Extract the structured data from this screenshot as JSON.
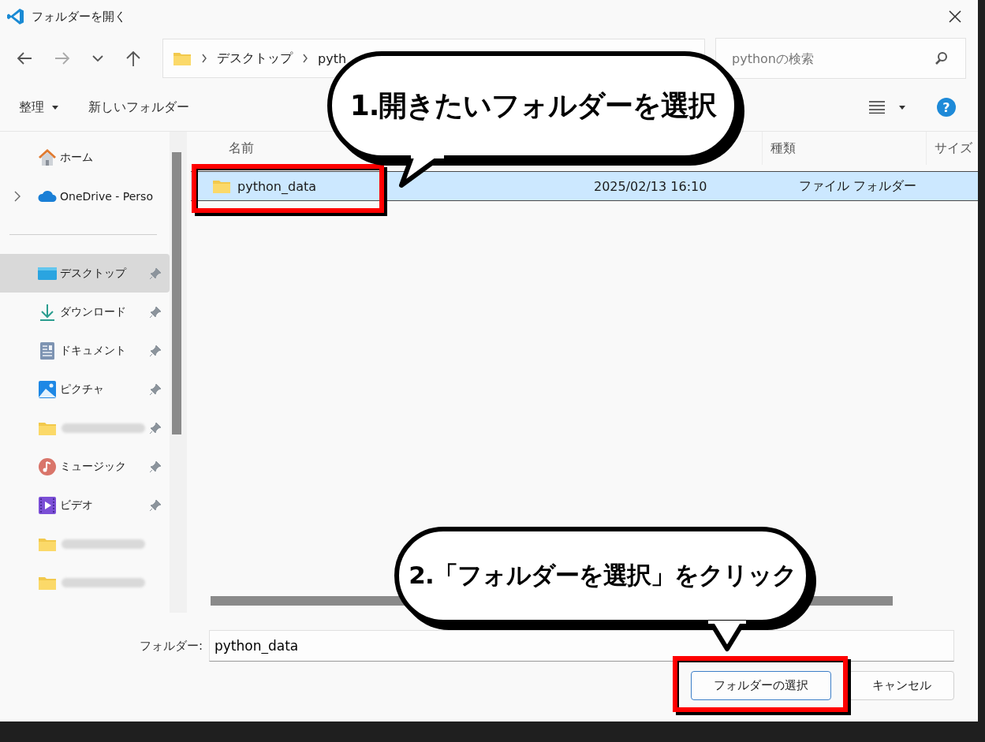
{
  "window": {
    "title": "フォルダーを開く"
  },
  "navigation": {
    "breadcrumbs": [
      "デスクトップ",
      "pyth"
    ],
    "search": {
      "placeholder": "pythonの検索"
    }
  },
  "toolbar": {
    "organize": "整理",
    "new_folder": "新しいフォルダー",
    "help": "?"
  },
  "sidebar": {
    "items": [
      {
        "kind": "home",
        "label": "ホーム",
        "selected": false,
        "pinned": false
      },
      {
        "kind": "cloud",
        "label": "OneDrive - Perso",
        "selected": false,
        "pinned": false,
        "expandable": true
      },
      {
        "kind": "divider"
      },
      {
        "kind": "desktop",
        "label": "デスクトップ",
        "selected": true,
        "pinned": true
      },
      {
        "kind": "download",
        "label": "ダウンロード",
        "selected": false,
        "pinned": true
      },
      {
        "kind": "document",
        "label": "ドキュメント",
        "selected": false,
        "pinned": true
      },
      {
        "kind": "picture",
        "label": "ピクチャ",
        "selected": false,
        "pinned": true
      },
      {
        "kind": "folder",
        "redacted": true,
        "selected": false,
        "pinned": true
      },
      {
        "kind": "music",
        "label": "ミュージック",
        "selected": false,
        "pinned": true
      },
      {
        "kind": "video",
        "label": "ビデオ",
        "selected": false,
        "pinned": true
      },
      {
        "kind": "folder",
        "redacted": true,
        "selected": false,
        "pinned": false
      },
      {
        "kind": "folder",
        "redacted": true,
        "selected": false,
        "pinned": false
      }
    ]
  },
  "file_list": {
    "columns": [
      {
        "kind": "name",
        "label": "名前"
      },
      {
        "kind": "type",
        "label": "種類"
      },
      {
        "kind": "size",
        "label": "サイズ"
      }
    ],
    "rows": [
      {
        "name": "python_data",
        "date": "2025/02/13 16:10",
        "type": "ファイル フォルダー",
        "selected": true
      }
    ]
  },
  "footer": {
    "folder_label": "フォルダー:",
    "folder_value": "python_data",
    "buttons": [
      {
        "label": "フォルダーの選択",
        "kind": "primary"
      },
      {
        "label": "キャンセル",
        "kind": "secondary"
      }
    ]
  },
  "annotations": [
    {
      "text": "1.開きたいフォルダーを選択"
    },
    {
      "text": "2.「フォルダーを選択」をクリック"
    }
  ]
}
